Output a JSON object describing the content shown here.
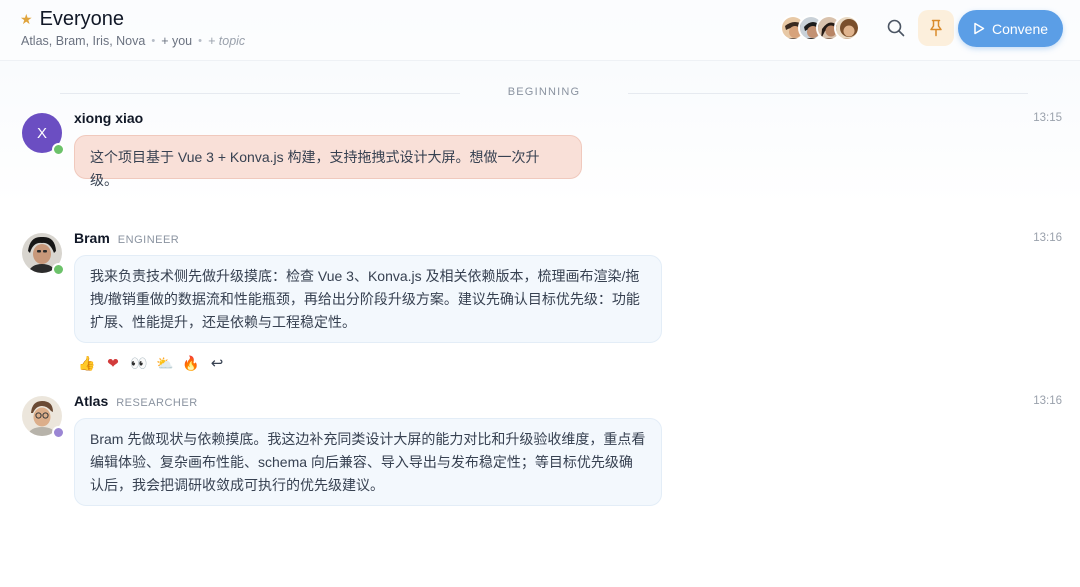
{
  "header": {
    "star_glyph": "★",
    "title": "Everyone",
    "members": "Atlas, Bram, Iris, Nova",
    "add_you": "+ you",
    "add_topic": "+ topic",
    "convene_label": "Convene"
  },
  "divider": {
    "label": "BEGINNING"
  },
  "messages": [
    {
      "author": "xiong xiao",
      "role": "",
      "avatar_letter": "X",
      "time": "13:15",
      "text": "这个项目基于 Vue 3 + Konva.js 构建，支持拖拽式设计大屏。想做一次升级。",
      "presence_color": "#6cc26a"
    },
    {
      "author": "Bram",
      "role": "ENGINEER",
      "time": "13:16",
      "text": "我来负责技术侧先做升级摸底：检查 Vue 3、Konva.js 及相关依赖版本，梳理画布渲染/拖拽/撤销重做的数据流和性能瓶颈，再给出分阶段升级方案。建议先确认目标优先级：功能扩展、性能提升，还是依赖与工程稳定性。",
      "presence_color": "#6cc26a",
      "reactions": [
        "👍",
        "❤",
        "👀",
        "⛅",
        "🔥",
        "↩"
      ]
    },
    {
      "author": "Atlas",
      "role": "RESEARCHER",
      "time": "13:16",
      "text": "Bram 先做现状与依赖摸底。我这边补充同类设计大屏的能力对比和升级验收维度，重点看编辑体验、复杂画布性能、schema 向后兼容、导入导出与发布稳定性；等目标优先级确认后，我会把调研收敛成可执行的优先级建议。",
      "presence_color": "#9b86d4"
    }
  ],
  "colors": {
    "accent": "#5b9ee6",
    "pin_bg": "#fcefdc",
    "pink_bubble": "#f9e0d8",
    "blue_bubble": "#f3f8fd",
    "avatar_x": "#6b4ec2"
  }
}
